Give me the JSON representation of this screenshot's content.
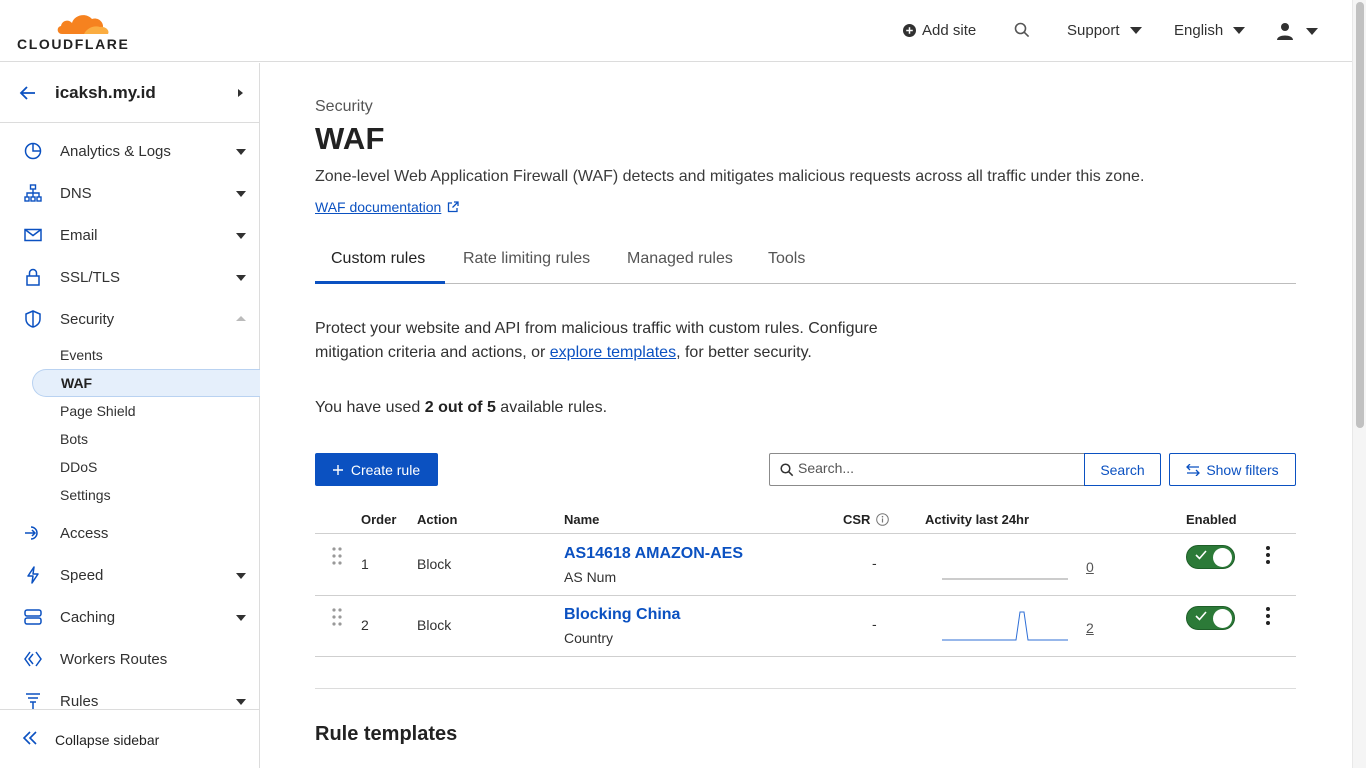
{
  "header": {
    "logo_text": "CLOUDFLARE",
    "add_site": "Add site",
    "support": "Support",
    "language": "English"
  },
  "sidebar": {
    "site": "icaksh.my.id",
    "items": [
      {
        "label": "Analytics & Logs",
        "icon": "analytics-icon"
      },
      {
        "label": "DNS",
        "icon": "dns-icon"
      },
      {
        "label": "Email",
        "icon": "email-icon"
      },
      {
        "label": "SSL/TLS",
        "icon": "lock-icon"
      },
      {
        "label": "Security",
        "icon": "shield-icon"
      },
      {
        "label": "Access",
        "icon": "access-icon"
      },
      {
        "label": "Speed",
        "icon": "lightning-icon"
      },
      {
        "label": "Caching",
        "icon": "caching-icon"
      },
      {
        "label": "Workers Routes",
        "icon": "workers-icon"
      },
      {
        "label": "Rules",
        "icon": "rules-icon"
      }
    ],
    "security_sub": [
      "Events",
      "WAF",
      "Page Shield",
      "Bots",
      "DDoS",
      "Settings"
    ],
    "collapse_label": "Collapse sidebar"
  },
  "main": {
    "eyebrow": "Security",
    "title": "WAF",
    "description": "Zone-level Web Application Firewall (WAF) detects and mitigates malicious requests across all traffic under this zone.",
    "doc_link": "WAF documentation",
    "tabs": [
      "Custom rules",
      "Rate limiting rules",
      "Managed rules",
      "Tools"
    ],
    "intro_before": "Protect your website and API from malicious traffic with custom rules. Configure mitigation criteria and actions, or ",
    "intro_link": "explore templates",
    "intro_after": ", for better security.",
    "usage_before": "You have used ",
    "usage_bold": "2 out of 5",
    "usage_after": " available rules.",
    "create_rule": "Create rule",
    "search_placeholder": "Search...",
    "search_button": "Search",
    "show_filters": "Show filters",
    "section_title": "Rule templates"
  },
  "table": {
    "columns": [
      "Order",
      "Action",
      "Name",
      "CSR",
      "Activity last 24hr",
      "Enabled"
    ],
    "rows": [
      {
        "order": "1",
        "action": "Block",
        "name": "AS14618 AMAZON-AES",
        "type": "AS Num",
        "csr": "-",
        "activity": "0",
        "enabled": true
      },
      {
        "order": "2",
        "action": "Block",
        "name": "Blocking China",
        "type": "Country",
        "csr": "-",
        "activity": "2",
        "enabled": true
      }
    ]
  },
  "colors": {
    "accent": "#0b51c1",
    "brand_orange": "#f6821f",
    "toggle_on": "#2c7a38"
  }
}
